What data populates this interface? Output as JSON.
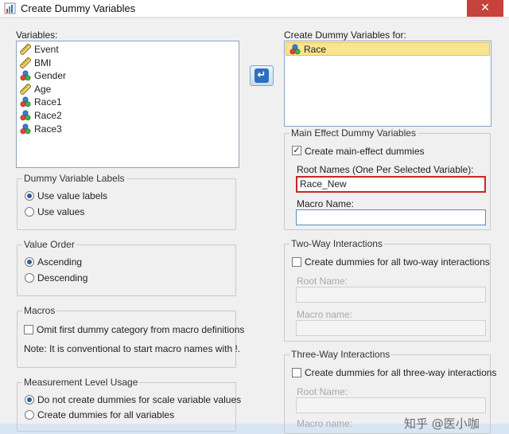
{
  "window": {
    "title": "Create Dummy Variables",
    "close_glyph": "✕"
  },
  "variables": {
    "label": "Variables:",
    "items": [
      {
        "name": "Event",
        "icon": "scale-ruler-icon"
      },
      {
        "name": "BMI",
        "icon": "scale-ruler-icon"
      },
      {
        "name": "Gender",
        "icon": "nominal-balls-icon"
      },
      {
        "name": "Age",
        "icon": "scale-ruler-icon"
      },
      {
        "name": "Race1",
        "icon": "nominal-balls-icon"
      },
      {
        "name": "Race2",
        "icon": "nominal-balls-icon"
      },
      {
        "name": "Race3",
        "icon": "nominal-balls-icon"
      }
    ]
  },
  "move_button": {
    "glyph": "↵"
  },
  "target": {
    "label": "Create Dummy Variables for:",
    "items": [
      {
        "name": "Race",
        "icon": "nominal-balls-icon",
        "selected": true
      }
    ]
  },
  "dummy_labels": {
    "legend": "Dummy Variable Labels",
    "options": [
      {
        "label": "Use value labels",
        "selected": true
      },
      {
        "label": "Use values",
        "selected": false
      }
    ]
  },
  "value_order": {
    "legend": "Value Order",
    "options": [
      {
        "label": "Ascending",
        "selected": true
      },
      {
        "label": "Descending",
        "selected": false
      }
    ]
  },
  "macros": {
    "legend": "Macros",
    "omit_first_label": "Omit first dummy category from macro definitions",
    "omit_first_checked": false,
    "note": "Note: It is conventional to start macro names with !."
  },
  "measurement": {
    "legend": "Measurement Level Usage",
    "options": [
      {
        "label": "Do not create dummies for scale variable values",
        "selected": true
      },
      {
        "label": "Create dummies for all variables",
        "selected": false
      }
    ]
  },
  "main_effect": {
    "legend": "Main Effect Dummy Variables",
    "create_label": "Create main-effect dummies",
    "create_checked": true,
    "root_label": "Root Names (One Per Selected Variable):",
    "root_value": "Race_New",
    "macro_label": "Macro Name:",
    "macro_value": ""
  },
  "two_way": {
    "legend": "Two-Way Interactions",
    "create_label": "Create dummies for all two-way interactions",
    "create_checked": false,
    "root_label": "Root Name:",
    "macro_label": "Macro name:"
  },
  "three_way": {
    "legend": "Three-Way Interactions",
    "create_label": "Create dummies for all three-way interactions",
    "create_checked": false,
    "root_label": "Root Name:",
    "macro_label": "Macro name:"
  },
  "watermark": "知乎 @医小咖",
  "colors": {
    "selection": "#f7e58f",
    "highlight_border": "#c62828",
    "accent_blue": "#2e6fbd"
  }
}
